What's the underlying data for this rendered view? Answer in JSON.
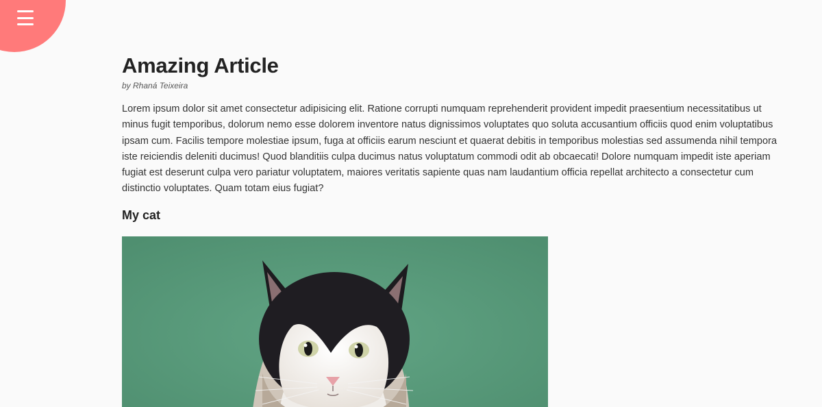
{
  "menu": {
    "icon": "hamburger-menu-icon",
    "accent_color": "#ff7a7a"
  },
  "article": {
    "title": "Amazing Article",
    "byline": "by Rhaná Teixeira",
    "body": "Lorem ipsum dolor sit amet consectetur adipisicing elit. Ratione corrupti numquam reprehenderit provident impedit praesentium necessitatibus ut minus fugit temporibus, dolorum nemo esse dolorem inventore natus dignissimos voluptates quo soluta accusantium officiis quod enim voluptatibus ipsam cum. Facilis tempore molestiae ipsum, fuga at officiis earum nesciunt et quaerat debitis in temporibus molestias sed assumenda nihil tempora iste reiciendis deleniti ducimus! Quod blanditiis culpa ducimus natus voluptatum commodi odit ab obcaecati! Dolore numquam impedit iste aperiam fugiat est deserunt culpa vero pariatur voluptatem, maiores veritatis sapiente quas nam laudantium officia repellat architecto a consectetur cum distinctio voluptates. Quam totam eius fugiat?",
    "section_heading": "My cat"
  },
  "photo": {
    "subject": "cat-photo",
    "background_color": "#5d9e7e"
  }
}
